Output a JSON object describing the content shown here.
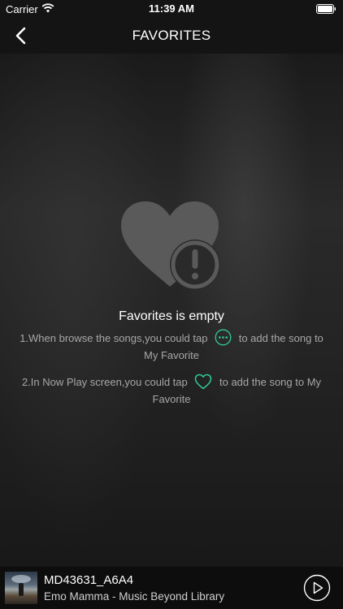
{
  "status_bar": {
    "carrier": "Carrier",
    "time": "11:39 AM",
    "wifi_icon": "wifi-icon",
    "battery_icon": "battery-icon"
  },
  "nav": {
    "title": "FAVORITES",
    "back_icon": "chevron-left-icon"
  },
  "empty_state": {
    "icon": "heart-warning-icon",
    "title": "Favorites is empty",
    "tip1_before": "1.When browse the songs,you could tap",
    "tip1_icon": "more-options-icon",
    "tip1_after": "to add the song to My Favorite",
    "tip2_before": "2.In Now Play screen,you could tap",
    "tip2_icon": "heart-outline-icon",
    "tip2_after": "to add the song to My Favorite"
  },
  "now_playing": {
    "title": "MD43631_A6A4",
    "subtitle": "Emo Mamma - Music Beyond Library",
    "play_icon": "play-icon"
  },
  "colors": {
    "accent": "#2ecc9a",
    "bar_background": "#141414",
    "tip_text": "#a7a7a7"
  }
}
